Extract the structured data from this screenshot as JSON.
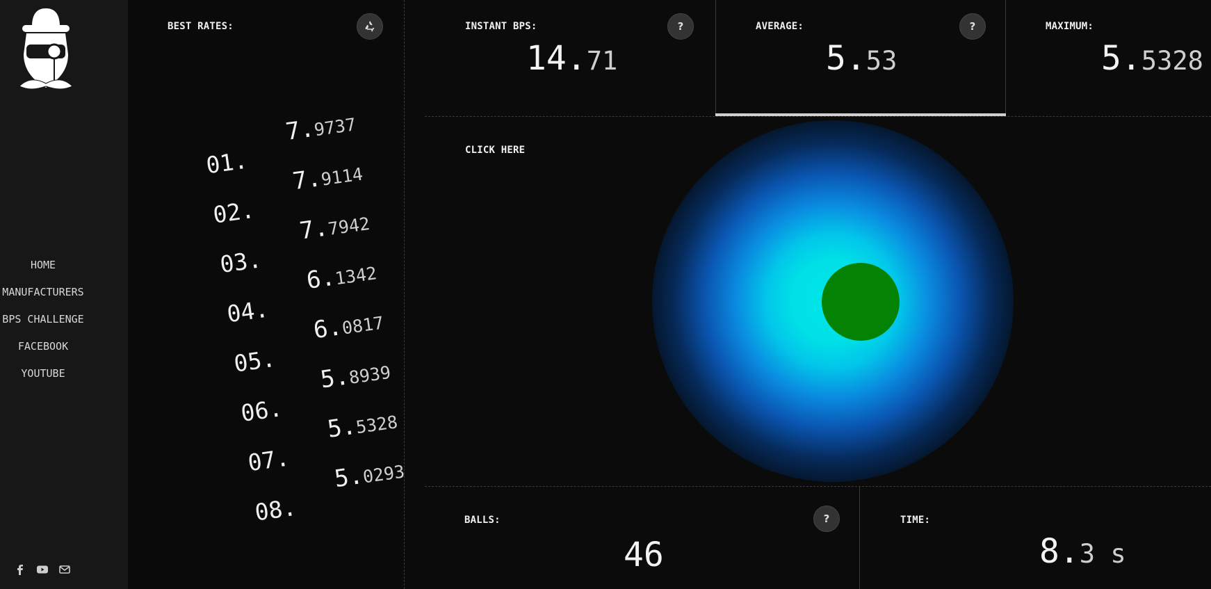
{
  "sidebar": {
    "nav": [
      "HOME",
      "MANUFACTURERS",
      "BPS CHALLENGE",
      "FACEBOOK",
      "YOUTUBE"
    ],
    "social_icons": [
      "facebook-icon",
      "youtube-icon",
      "mail-icon"
    ]
  },
  "best_rates": {
    "label": "BEST RATES:",
    "reset_icon": "recycle-icon",
    "entries": [
      {
        "rank": "01.",
        "int": "7.",
        "dec": "9737"
      },
      {
        "rank": "02.",
        "int": "7.",
        "dec": "9114"
      },
      {
        "rank": "03.",
        "int": "7.",
        "dec": "7942"
      },
      {
        "rank": "04.",
        "int": "6.",
        "dec": "1342"
      },
      {
        "rank": "05.",
        "int": "6.",
        "dec": "0817"
      },
      {
        "rank": "06.",
        "int": "5.",
        "dec": "8939"
      },
      {
        "rank": "07.",
        "int": "5.",
        "dec": "5328"
      },
      {
        "rank": "08.",
        "int": "5.",
        "dec": "0293"
      }
    ]
  },
  "stats": {
    "instant": {
      "label": "INSTANT BPS:",
      "int": "14.",
      "dec": "71",
      "help": "?"
    },
    "average": {
      "label": "AVERAGE:",
      "int": "5.",
      "dec": "53",
      "help": "?"
    },
    "maximum": {
      "label": "MAXIMUM:",
      "int": "5.",
      "dec": "5328"
    },
    "balls": {
      "label": "BALLS:",
      "value": "46",
      "help": "?"
    },
    "time": {
      "label": "TIME:",
      "int": "8.",
      "dec": "3 s"
    }
  },
  "click_area": {
    "label": "CLICK HERE",
    "ball_color": "#038203",
    "glow_colors": [
      "#00e6e6",
      "#0a8ae0",
      "#062a5a"
    ]
  }
}
